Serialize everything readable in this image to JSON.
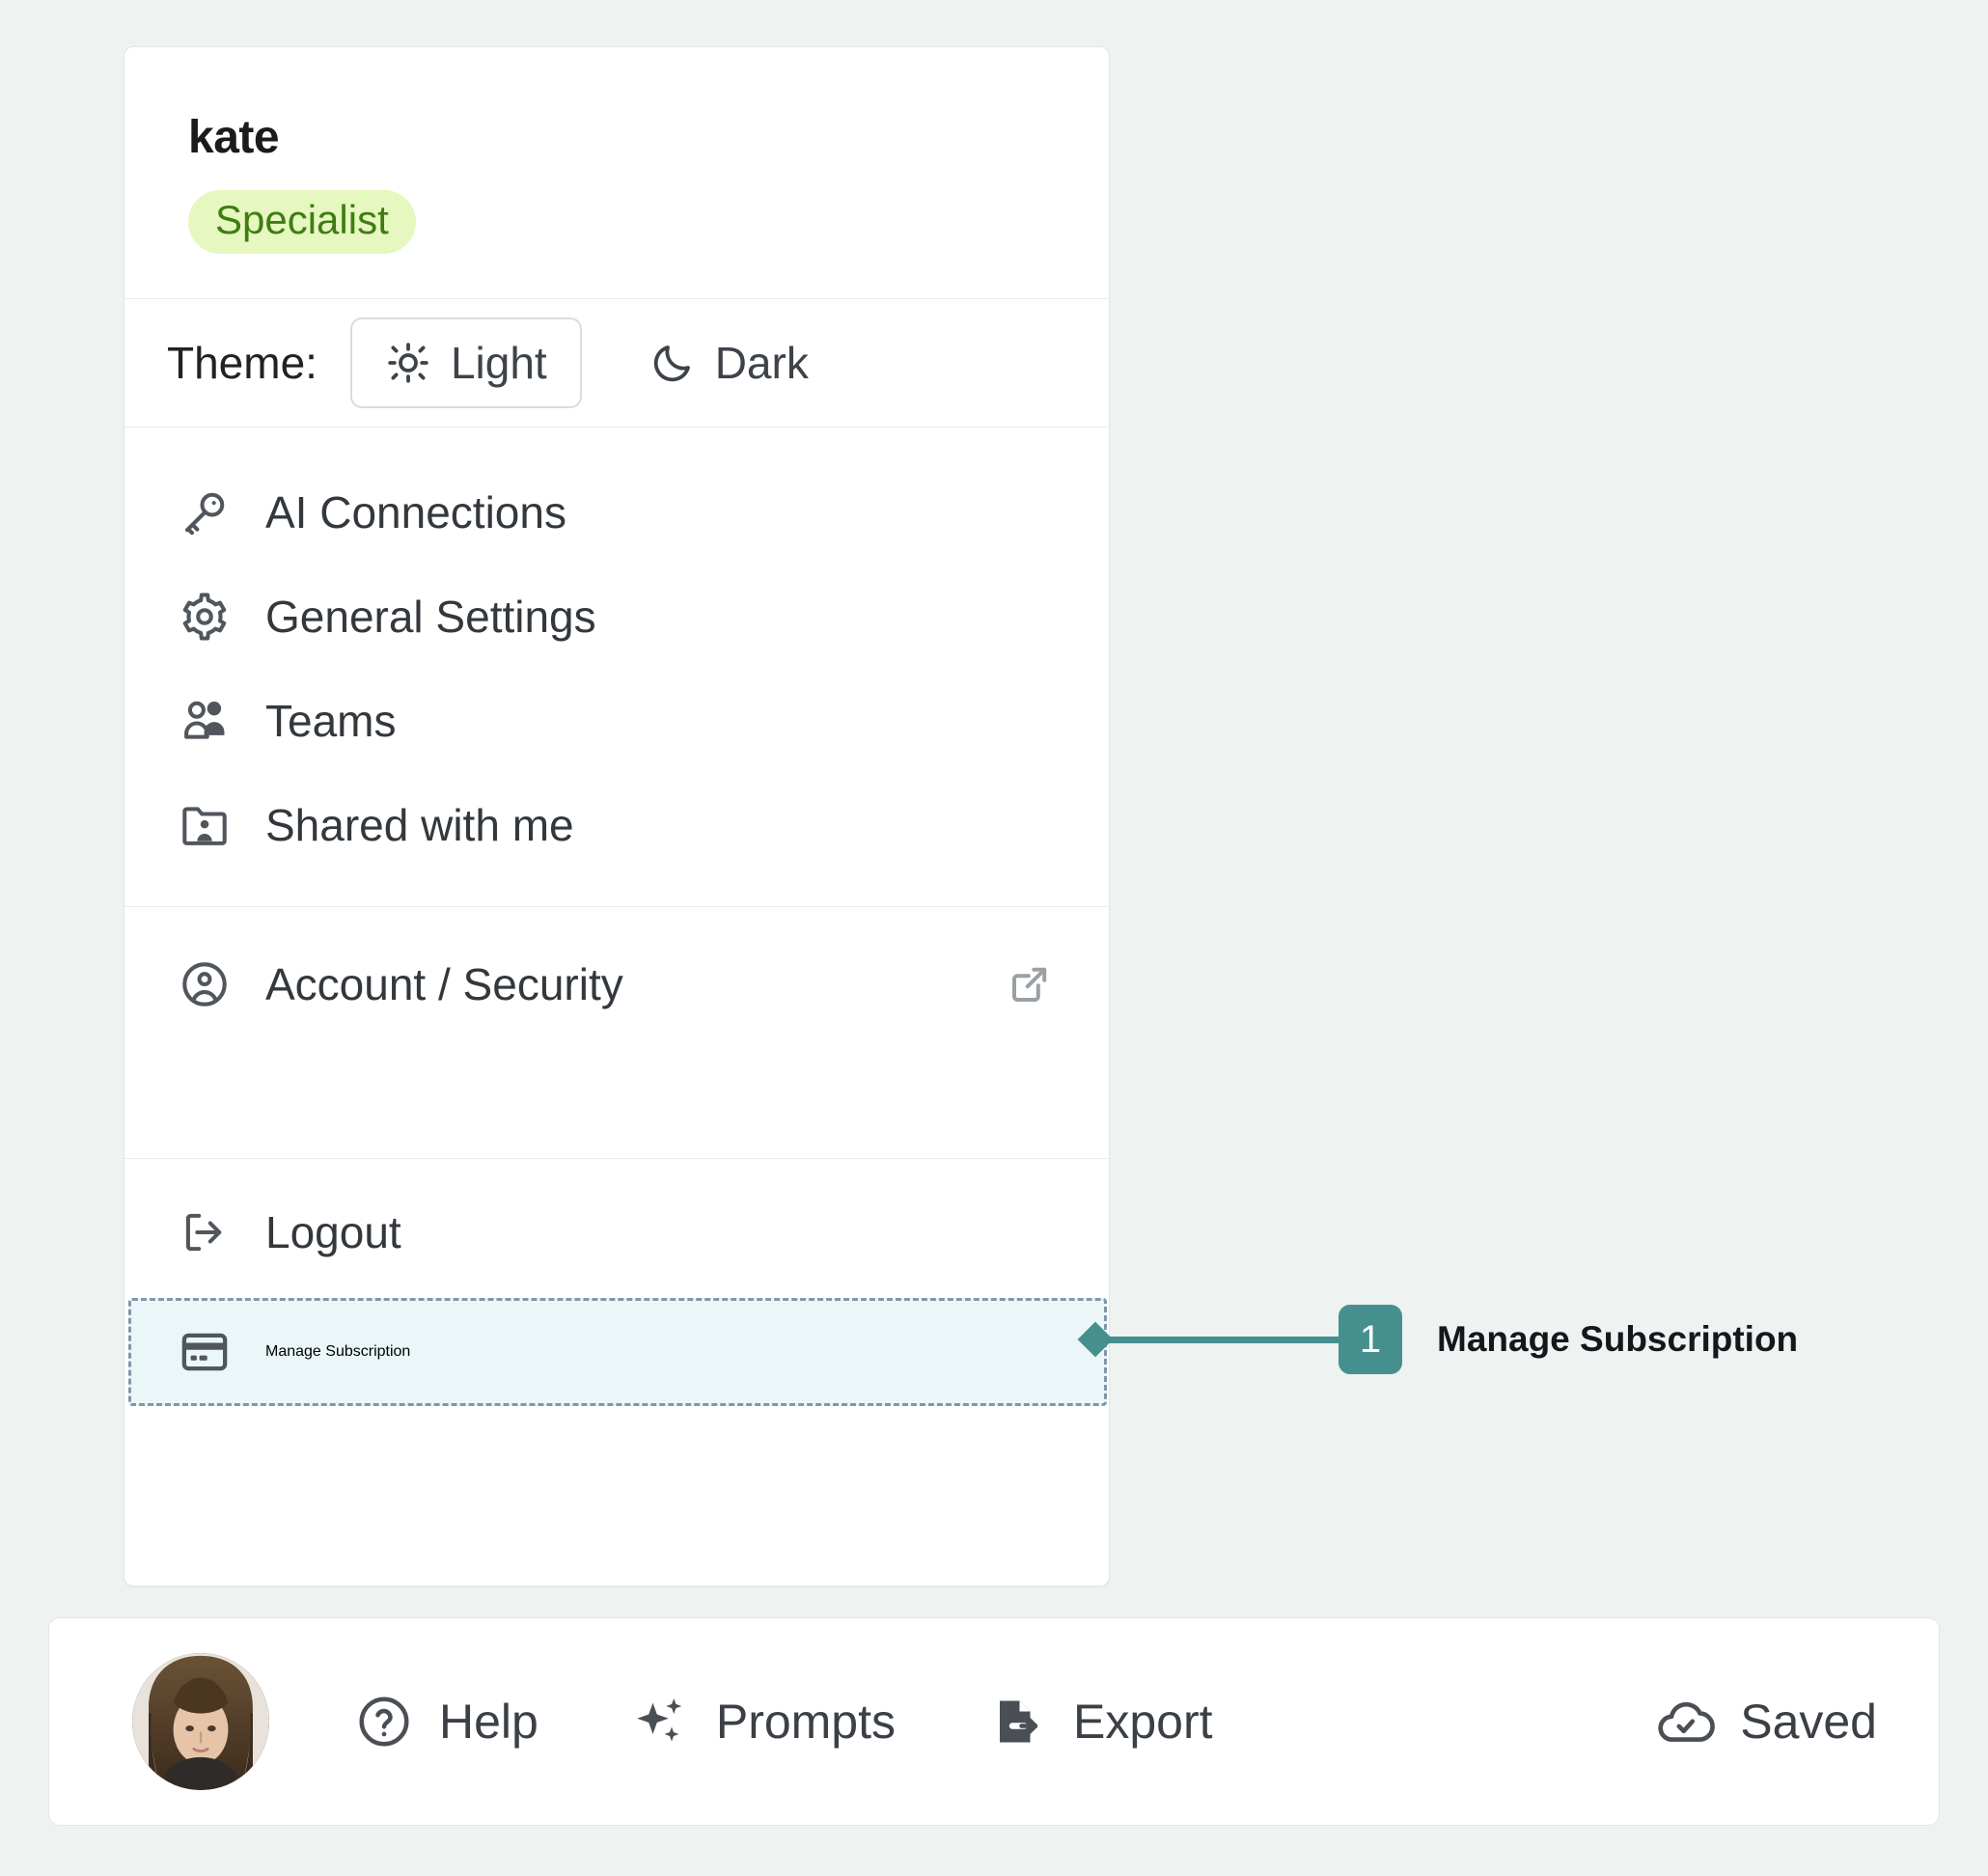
{
  "profile": {
    "name": "kate",
    "plan_badge": "Specialist",
    "badge_bg": "#e6f7bf",
    "badge_text_color": "#3f7d12"
  },
  "theme": {
    "label": "Theme:",
    "options": [
      {
        "label": "Light",
        "icon": "sun-icon",
        "selected": true
      },
      {
        "label": "Dark",
        "icon": "moon-icon",
        "selected": false
      }
    ]
  },
  "menu": {
    "group_one": [
      {
        "label": "AI Connections",
        "icon": "key-icon"
      },
      {
        "label": "General Settings",
        "icon": "gear-icon"
      },
      {
        "label": "Teams",
        "icon": "users-icon"
      },
      {
        "label": "Shared with me",
        "icon": "folder-user-icon"
      }
    ],
    "group_two": [
      {
        "label": "Account / Security",
        "icon": "user-circle-icon",
        "trailing_icon": "external-link-icon"
      },
      {
        "label": "Manage Subscription",
        "icon": "credit-card-icon",
        "highlighted": true
      }
    ],
    "group_three": [
      {
        "label": "Logout",
        "icon": "logout-icon"
      }
    ]
  },
  "annotation": {
    "number": "1",
    "text": "Manage Subscription",
    "color": "#45908f"
  },
  "bottom_bar": {
    "avatar_alt": "user-avatar",
    "items": [
      {
        "label": "Help",
        "icon": "question-circle-icon"
      },
      {
        "label": "Prompts",
        "icon": "sparkles-icon"
      },
      {
        "label": "Export",
        "icon": "export-file-icon"
      },
      {
        "label": "Saved",
        "icon": "cloud-check-icon"
      }
    ]
  },
  "colors": {
    "page_background": "#eef2f1",
    "card_background": "#ffffff",
    "highlight_fill": "#eaf6f8",
    "highlight_border": "#8196ab",
    "accent": "#45908f"
  }
}
